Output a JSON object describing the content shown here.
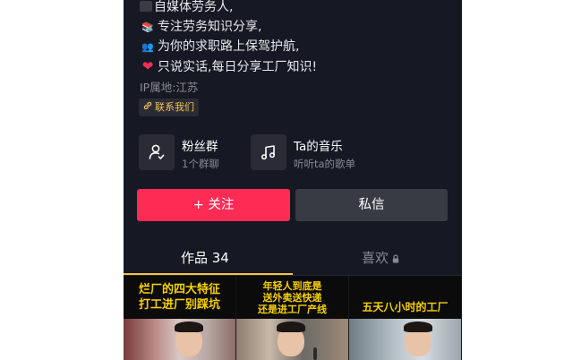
{
  "profile": {
    "bio_lines": [
      {
        "icon": "gray-block-icon",
        "text": "自媒体劳务人,"
      },
      {
        "icon": "books-icon",
        "emoji": "📚",
        "text": "专注劳务知识分享,"
      },
      {
        "icon": "people-icon",
        "emoji": "👥",
        "text": "为你的求职路上保驾护航,"
      },
      {
        "icon": "heart-icon",
        "emoji": "❤",
        "text": "只说实话,每日分享工厂知识!"
      }
    ],
    "ip_location": "IP属地:江苏",
    "contact_label": "联系我们"
  },
  "features": {
    "fans_group": {
      "title": "粉丝群",
      "subtitle": "1个群聊",
      "icon": "fan-group-icon"
    },
    "music": {
      "title": "Ta的音乐",
      "subtitle": "听听ta的歌单",
      "icon": "music-note-icon"
    }
  },
  "actions": {
    "follow_label": "+ 关注",
    "message_label": "私信"
  },
  "tabs": {
    "works_label": "作品 34",
    "likes_label": "喜欢"
  },
  "videos": [
    {
      "caption_lines": [
        "烂厂的四大特征",
        "打工进厂别踩坑"
      ]
    },
    {
      "caption_lines": [
        "年轻人到底是",
        "送外卖送快递",
        "还是进工厂产线"
      ]
    },
    {
      "caption_lines": [
        "五天八小时的工厂"
      ]
    }
  ],
  "colors": {
    "background": "#161823",
    "accent_red": "#fe2c55",
    "tab_underline": "#f5c33b",
    "caption_yellow": "#f8d000",
    "contact_gold": "#f6c15b"
  }
}
